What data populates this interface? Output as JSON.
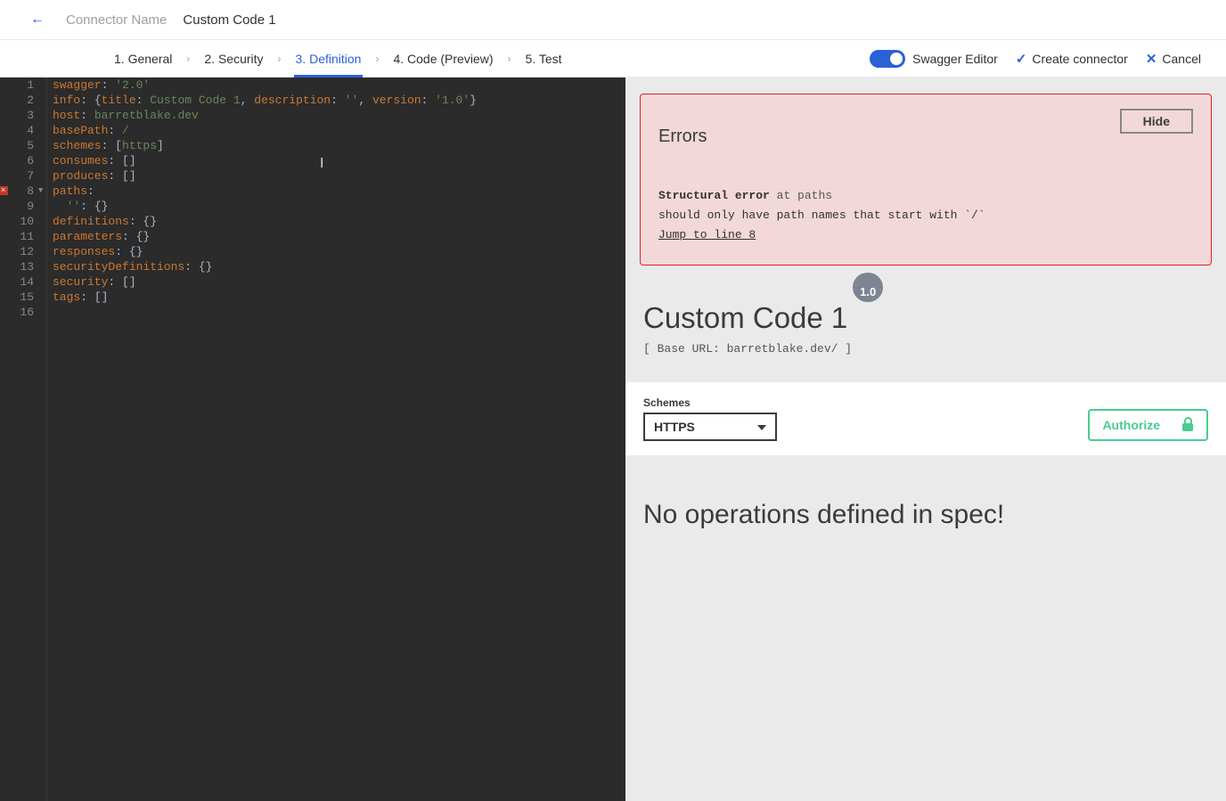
{
  "header": {
    "connector_label": "Connector Name",
    "connector_name": "Custom Code 1"
  },
  "tabs": [
    {
      "label": "1. General",
      "active": false
    },
    {
      "label": "2. Security",
      "active": false
    },
    {
      "label": "3. Definition",
      "active": true
    },
    {
      "label": "4. Code (Preview)",
      "active": false
    },
    {
      "label": "5. Test",
      "active": false
    }
  ],
  "actions": {
    "swagger_toggle_label": "Swagger Editor",
    "create_label": "Create connector",
    "cancel_label": "Cancel"
  },
  "editor": {
    "error_line": 8,
    "lines": [
      {
        "n": 1,
        "tokens": [
          [
            "key",
            "swagger"
          ],
          [
            "punc",
            ": "
          ],
          [
            "str",
            "'2.0'"
          ]
        ]
      },
      {
        "n": 2,
        "tokens": [
          [
            "key",
            "info"
          ],
          [
            "punc",
            ": {"
          ],
          [
            "key",
            "title"
          ],
          [
            "punc",
            ": "
          ],
          [
            "str",
            "Custom Code 1"
          ],
          [
            "punc",
            ", "
          ],
          [
            "key",
            "description"
          ],
          [
            "punc",
            ": "
          ],
          [
            "str",
            "''"
          ],
          [
            "punc",
            ", "
          ],
          [
            "key",
            "version"
          ],
          [
            "punc",
            ": "
          ],
          [
            "str",
            "'1.0'"
          ],
          [
            "punc",
            "}"
          ]
        ]
      },
      {
        "n": 3,
        "tokens": [
          [
            "key",
            "host"
          ],
          [
            "punc",
            ": "
          ],
          [
            "str",
            "barretblake.dev"
          ]
        ]
      },
      {
        "n": 4,
        "tokens": [
          [
            "key",
            "basePath"
          ],
          [
            "punc",
            ": "
          ],
          [
            "str",
            "/"
          ]
        ]
      },
      {
        "n": 5,
        "tokens": [
          [
            "key",
            "schemes"
          ],
          [
            "punc",
            ": ["
          ],
          [
            "str",
            "https"
          ],
          [
            "punc",
            "]"
          ]
        ]
      },
      {
        "n": 6,
        "tokens": [
          [
            "key",
            "consumes"
          ],
          [
            "punc",
            ": []"
          ]
        ]
      },
      {
        "n": 7,
        "tokens": [
          [
            "key",
            "produces"
          ],
          [
            "punc",
            ": []"
          ]
        ]
      },
      {
        "n": 8,
        "fold": true,
        "tokens": [
          [
            "key",
            "paths"
          ],
          [
            "punc",
            ":"
          ]
        ]
      },
      {
        "n": 9,
        "indent": 2,
        "tokens": [
          [
            "str",
            "''"
          ],
          [
            "punc",
            ": {}"
          ]
        ]
      },
      {
        "n": 10,
        "tokens": [
          [
            "key",
            "definitions"
          ],
          [
            "punc",
            ": {}"
          ]
        ]
      },
      {
        "n": 11,
        "tokens": [
          [
            "key",
            "parameters"
          ],
          [
            "punc",
            ": {}"
          ]
        ]
      },
      {
        "n": 12,
        "tokens": [
          [
            "key",
            "responses"
          ],
          [
            "punc",
            ": {}"
          ]
        ]
      },
      {
        "n": 13,
        "tokens": [
          [
            "key",
            "securityDefinitions"
          ],
          [
            "punc",
            ": {}"
          ]
        ]
      },
      {
        "n": 14,
        "tokens": [
          [
            "key",
            "security"
          ],
          [
            "punc",
            ": []"
          ]
        ]
      },
      {
        "n": 15,
        "tokens": [
          [
            "key",
            "tags"
          ],
          [
            "punc",
            ": []"
          ]
        ]
      },
      {
        "n": 16,
        "tokens": []
      }
    ]
  },
  "preview": {
    "errors_title": "Errors",
    "hide_label": "Hide",
    "error_heading": "Structural error",
    "error_at": "at paths",
    "error_msg": "should only have path names that start with `/`",
    "jump_label": "Jump to line 8",
    "api_title": "Custom Code 1",
    "version_badge": "1.0",
    "base_url": "[ Base URL: barretblake.dev/ ]",
    "schemes_label": "Schemes",
    "scheme_selected": "HTTPS",
    "authorize_label": "Authorize",
    "no_ops": "No operations defined in spec!"
  }
}
